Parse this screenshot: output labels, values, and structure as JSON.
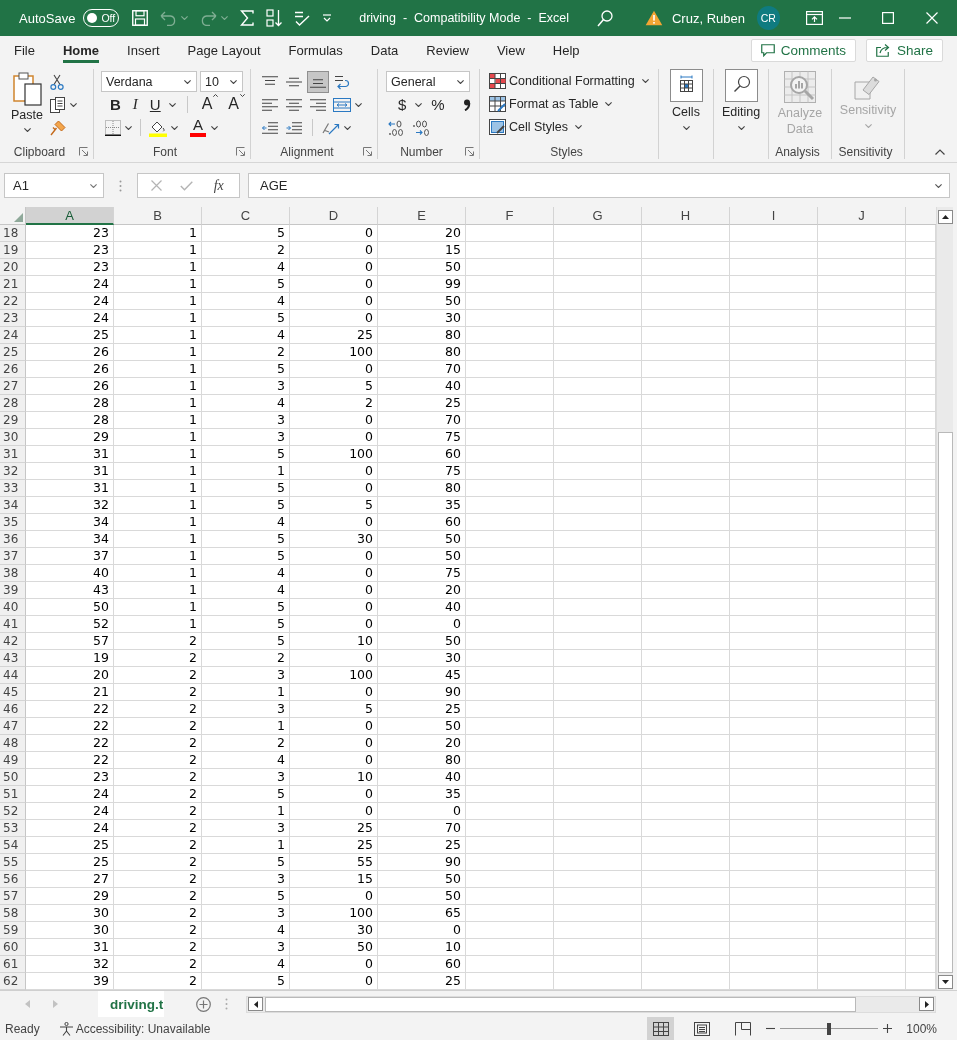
{
  "title_bar": {
    "autosave_label": "AutoSave",
    "autosave": {
      "on": false,
      "label": "Off"
    },
    "quick_access": [
      {
        "kind": "save",
        "disabled": false
      },
      {
        "kind": "undo",
        "disabled": true
      },
      {
        "kind": "redo",
        "disabled": true
      },
      {
        "kind": "sum",
        "disabled": false
      },
      {
        "kind": "sort",
        "disabled": false
      },
      {
        "kind": "spelling",
        "disabled": false
      },
      {
        "kind": "customize",
        "disabled": false
      }
    ],
    "title": "driving  -  Compatibility Mode  -  Excel",
    "user": "Cruz, Ruben",
    "avatar": "CR"
  },
  "tabs": [
    {
      "label": "File",
      "selected": false
    },
    {
      "label": "Home",
      "selected": true
    },
    {
      "label": "Insert",
      "selected": false
    },
    {
      "label": "Page Layout",
      "selected": false
    },
    {
      "label": "Formulas",
      "selected": false
    },
    {
      "label": "Data",
      "selected": false
    },
    {
      "label": "Review",
      "selected": false
    },
    {
      "label": "View",
      "selected": false
    },
    {
      "label": "Help",
      "selected": false
    }
  ],
  "actions": [
    {
      "kind": "comments",
      "label": "Comments"
    },
    {
      "kind": "share",
      "label": "Share"
    }
  ],
  "ribbon": {
    "clipboard": {
      "label": "Clipboard",
      "paste": "Paste"
    },
    "font": {
      "label": "Font",
      "font_name": "Verdana",
      "font_size": "10",
      "styles": [
        {
          "kind": "bold",
          "label": "B"
        },
        {
          "kind": "italic",
          "label": "I"
        },
        {
          "kind": "underline",
          "label": "U"
        }
      ],
      "grow": "A",
      "shrink": "A",
      "font_color": "A"
    },
    "alignment": {
      "label": "Alignment",
      "vertical": [
        {
          "kind": "top",
          "selected": false
        },
        {
          "kind": "middle",
          "selected": false
        },
        {
          "kind": "bottom",
          "selected": true
        }
      ],
      "horizontal": [
        {
          "kind": "left",
          "selected": false
        },
        {
          "kind": "center",
          "selected": false
        },
        {
          "kind": "right",
          "selected": false
        }
      ]
    },
    "number": {
      "label": "Number",
      "format": "General",
      "currency": "$",
      "percent": "%"
    },
    "styles": {
      "label": "Styles",
      "items": [
        {
          "kind": "conditional_formatting",
          "label": "Conditional Formatting"
        },
        {
          "kind": "format_as_table",
          "label": "Format as Table"
        },
        {
          "kind": "cell_styles",
          "label": "Cell Styles"
        }
      ]
    },
    "cells": {
      "label": "Cells"
    },
    "editing": {
      "label": "Editing"
    },
    "analysis": {
      "label": "Analysis",
      "button": "Analyze Data",
      "disabled": true
    },
    "sensitivity": {
      "label": "Sensitivity",
      "button": "Sensitivity",
      "disabled": true
    }
  },
  "formula_bar": {
    "name_box": "A1",
    "function_label": "fx",
    "formula": "AGE"
  },
  "sheet": {
    "columns": [
      {
        "label": "A",
        "selected": true
      },
      {
        "label": "B",
        "selected": false
      },
      {
        "label": "C",
        "selected": false
      },
      {
        "label": "D",
        "selected": false
      },
      {
        "label": "E",
        "selected": false
      },
      {
        "label": "F",
        "selected": false
      },
      {
        "label": "G",
        "selected": false
      },
      {
        "label": "H",
        "selected": false
      },
      {
        "label": "I",
        "selected": false
      },
      {
        "label": "J",
        "selected": false
      }
    ],
    "rows": [
      {
        "header": "18",
        "cells": [
          "23",
          "1",
          "5",
          "0",
          "20"
        ]
      },
      {
        "header": "19",
        "cells": [
          "23",
          "1",
          "2",
          "0",
          "15"
        ]
      },
      {
        "header": "20",
        "cells": [
          "23",
          "1",
          "4",
          "0",
          "50"
        ]
      },
      {
        "header": "21",
        "cells": [
          "24",
          "1",
          "5",
          "0",
          "99"
        ]
      },
      {
        "header": "22",
        "cells": [
          "24",
          "1",
          "4",
          "0",
          "50"
        ]
      },
      {
        "header": "23",
        "cells": [
          "24",
          "1",
          "5",
          "0",
          "30"
        ]
      },
      {
        "header": "24",
        "cells": [
          "25",
          "1",
          "4",
          "25",
          "80"
        ]
      },
      {
        "header": "25",
        "cells": [
          "26",
          "1",
          "2",
          "100",
          "80"
        ]
      },
      {
        "header": "26",
        "cells": [
          "26",
          "1",
          "5",
          "0",
          "70"
        ]
      },
      {
        "header": "27",
        "cells": [
          "26",
          "1",
          "3",
          "5",
          "40"
        ]
      },
      {
        "header": "28",
        "cells": [
          "28",
          "1",
          "4",
          "2",
          "25"
        ]
      },
      {
        "header": "29",
        "cells": [
          "28",
          "1",
          "3",
          "0",
          "70"
        ]
      },
      {
        "header": "30",
        "cells": [
          "29",
          "1",
          "3",
          "0",
          "75"
        ]
      },
      {
        "header": "31",
        "cells": [
          "31",
          "1",
          "5",
          "100",
          "60"
        ]
      },
      {
        "header": "32",
        "cells": [
          "31",
          "1",
          "1",
          "0",
          "75"
        ]
      },
      {
        "header": "33",
        "cells": [
          "31",
          "1",
          "5",
          "0",
          "80"
        ]
      },
      {
        "header": "34",
        "cells": [
          "32",
          "1",
          "5",
          "5",
          "35"
        ]
      },
      {
        "header": "35",
        "cells": [
          "34",
          "1",
          "4",
          "0",
          "60"
        ]
      },
      {
        "header": "36",
        "cells": [
          "34",
          "1",
          "5",
          "30",
          "50"
        ]
      },
      {
        "header": "37",
        "cells": [
          "37",
          "1",
          "5",
          "0",
          "50"
        ]
      },
      {
        "header": "38",
        "cells": [
          "40",
          "1",
          "4",
          "0",
          "75"
        ]
      },
      {
        "header": "39",
        "cells": [
          "43",
          "1",
          "4",
          "0",
          "20"
        ]
      },
      {
        "header": "40",
        "cells": [
          "50",
          "1",
          "5",
          "0",
          "40"
        ]
      },
      {
        "header": "41",
        "cells": [
          "52",
          "1",
          "5",
          "0",
          "0"
        ]
      },
      {
        "header": "42",
        "cells": [
          "57",
          "2",
          "5",
          "10",
          "50"
        ]
      },
      {
        "header": "43",
        "cells": [
          "19",
          "2",
          "2",
          "0",
          "30"
        ]
      },
      {
        "header": "44",
        "cells": [
          "20",
          "2",
          "3",
          "100",
          "45"
        ]
      },
      {
        "header": "45",
        "cells": [
          "21",
          "2",
          "1",
          "0",
          "90"
        ]
      },
      {
        "header": "46",
        "cells": [
          "22",
          "2",
          "3",
          "5",
          "25"
        ]
      },
      {
        "header": "47",
        "cells": [
          "22",
          "2",
          "1",
          "0",
          "50"
        ]
      },
      {
        "header": "48",
        "cells": [
          "22",
          "2",
          "2",
          "0",
          "20"
        ]
      },
      {
        "header": "49",
        "cells": [
          "22",
          "2",
          "4",
          "0",
          "80"
        ]
      },
      {
        "header": "50",
        "cells": [
          "23",
          "2",
          "3",
          "10",
          "40"
        ]
      },
      {
        "header": "51",
        "cells": [
          "24",
          "2",
          "5",
          "0",
          "35"
        ]
      },
      {
        "header": "52",
        "cells": [
          "24",
          "2",
          "1",
          "0",
          "0"
        ]
      },
      {
        "header": "53",
        "cells": [
          "24",
          "2",
          "3",
          "25",
          "70"
        ]
      },
      {
        "header": "54",
        "cells": [
          "25",
          "2",
          "1",
          "25",
          "25"
        ]
      },
      {
        "header": "55",
        "cells": [
          "25",
          "2",
          "5",
          "55",
          "90"
        ]
      },
      {
        "header": "56",
        "cells": [
          "27",
          "2",
          "3",
          "15",
          "50"
        ]
      },
      {
        "header": "57",
        "cells": [
          "29",
          "2",
          "5",
          "0",
          "50"
        ]
      },
      {
        "header": "58",
        "cells": [
          "30",
          "2",
          "3",
          "100",
          "65"
        ]
      },
      {
        "header": "59",
        "cells": [
          "30",
          "2",
          "4",
          "30",
          "0"
        ]
      },
      {
        "header": "60",
        "cells": [
          "31",
          "2",
          "3",
          "50",
          "10"
        ]
      },
      {
        "header": "61",
        "cells": [
          "32",
          "2",
          "4",
          "0",
          "60"
        ]
      },
      {
        "header": "62",
        "cells": [
          "39",
          "2",
          "5",
          "0",
          "25"
        ]
      }
    ]
  },
  "sheet_tabs": [
    {
      "label": "driving.t",
      "selected": true
    }
  ],
  "status_bar": {
    "status": "Ready",
    "accessibility": "Accessibility: Unavailable",
    "views": [
      {
        "kind": "normal",
        "selected": true
      },
      {
        "kind": "page_layout",
        "selected": false
      },
      {
        "kind": "page_break_preview",
        "selected": false
      }
    ],
    "zoom": {
      "level": 0.5,
      "label": "100%"
    }
  }
}
